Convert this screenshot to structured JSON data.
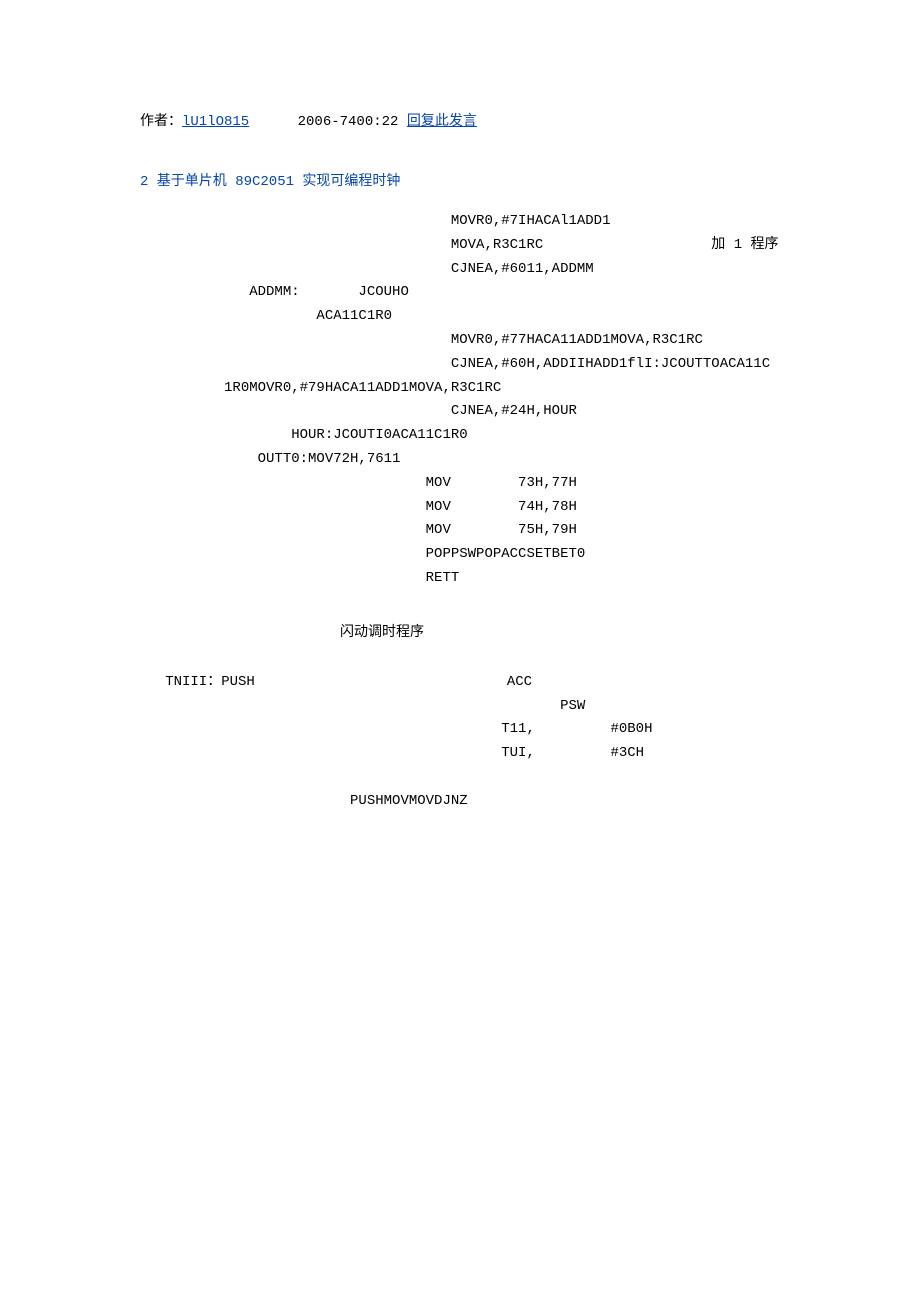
{
  "author": {
    "label": "作者：",
    "name": "lU1lO815",
    "timestamp": "2006-7400:22",
    "replyLink": "回复此发言"
  },
  "post": {
    "title": "2 基于单片机 89C2051 实现可编程时钟"
  },
  "code": {
    "line1": "                                     MOVR0,#7IHACAl1ADD1",
    "line2": "                                     MOVA,R3C1RC                    加 1 程序",
    "line3": "                                     CJNEA,#6011,ADDMM",
    "line4": "             ADDMM:       JCOUHO",
    "line5": "                     ACA11C1R0",
    "line6": "                                     MOVR0,#77HACA11ADD1MOVA,R3C1RC",
    "line7": "                                     CJNEA,#60H,ADDIIHADD1flI:JCOUTTOACA11C",
    "line8": "          1R0MOVR0,#79HACA11ADD1MOVA,R3C1RC",
    "line9": "                                     CJNEA,#24H,HOUR",
    "line10": "                  HOUR:JCOUTI0ACA11C1R0",
    "line11": "              OUTT0:MOV72H,7611",
    "line12": "                                  MOV        73H,77H",
    "line13": "                                  MOV        74H,78H",
    "line14": "                                  MOV        75H,79H",
    "line15": "                                  POPPSWPOPACCSETBET0",
    "line16": "                                  RETT"
  },
  "section": {
    "label": "闪动调时程序"
  },
  "code2": {
    "line1": "   TNIII：PUSH                              ACC",
    "line2": "                                                  PSW",
    "line3": "                                           T11,         #0B0H",
    "line4": "                                           TUI,         #3CH",
    "line5": "                         PUSHMOVMOVDJNZ"
  }
}
